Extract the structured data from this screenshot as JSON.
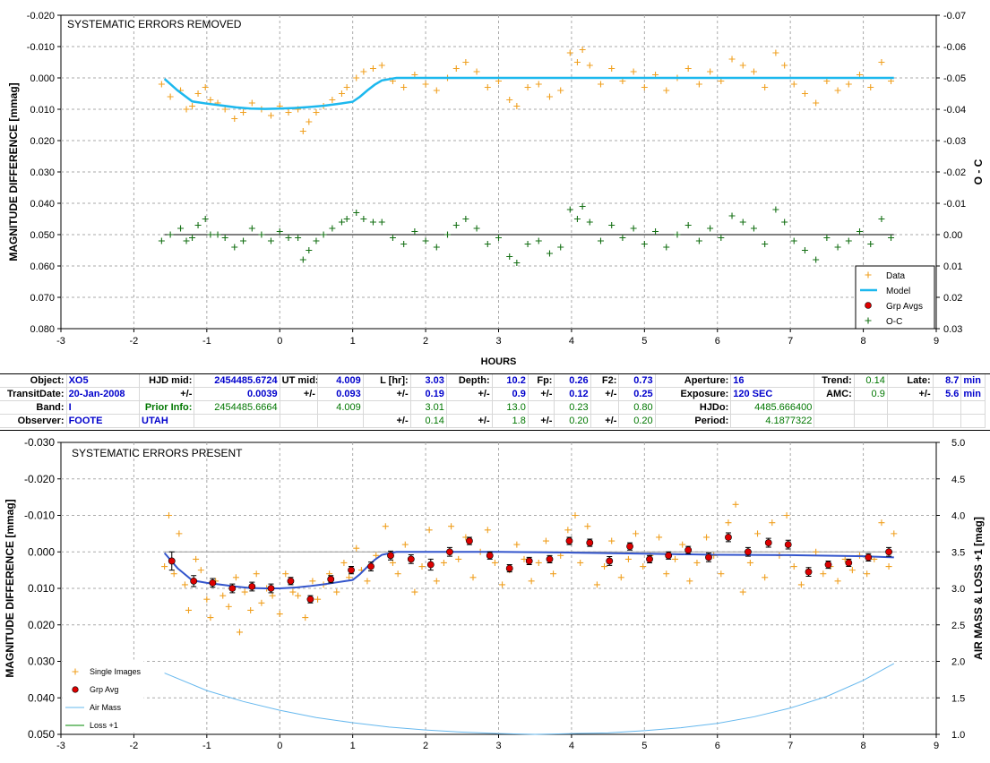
{
  "info_table": {
    "rows": [
      [
        "Object:",
        "XO5",
        "HJD mid:",
        "2454485.6724",
        "UT mid:",
        "4.009",
        "L [hr]:",
        "3.03",
        "Depth:",
        "10.2",
        "Fp:",
        "0.26",
        "F2:",
        "0.73",
        "Aperture:",
        "16",
        "Trend:",
        "0.14",
        "Late:",
        "8.7",
        "min"
      ],
      [
        "TransitDate:",
        "20-Jan-2008",
        "+/-",
        "0.0039",
        "+/-",
        "0.093",
        "+/-",
        "0.19",
        "+/-",
        "0.9",
        "+/-",
        "0.12",
        "+/-",
        "0.25",
        "Exposure:",
        "120 SEC",
        "AMC:",
        "0.9",
        "+/-",
        "5.6",
        "min"
      ],
      [
        "Band:",
        "I",
        "Prior Info:",
        "2454485.6664",
        "",
        "4.009",
        "",
        "3.01",
        "",
        "13.0",
        "",
        "0.23",
        "",
        "0.80",
        "HJDo:",
        "4485.666400",
        "",
        "",
        "",
        "",
        ""
      ],
      [
        "Observer:",
        "FOOTE",
        "UTAH",
        "",
        "",
        "",
        "+/-",
        "0.14",
        "+/-",
        "1.8",
        "+/-",
        "0.20",
        "+/-",
        "0.20",
        "Period:",
        "4.1877322",
        "",
        "",
        "",
        "",
        ""
      ]
    ]
  },
  "chart_data": [
    {
      "type": "scatter",
      "title": "SYSTEMATIC ERRORS REMOVED",
      "xlabel": "HOURS",
      "ylabel": "MAGNITUDE DIFFERENCE [mmag]",
      "y2label": "O - C",
      "xlim": [
        -3,
        9
      ],
      "ylim": [
        -0.02,
        0.08
      ],
      "y_inverted": true,
      "y2lim": [
        -0.07,
        0.03
      ],
      "x_ticks": [
        "-3",
        "-2",
        "-1",
        "0",
        "1",
        "2",
        "3",
        "4",
        "5",
        "6",
        "7",
        "8",
        "9"
      ],
      "y_ticks": [
        "-0.020",
        "-0.010",
        "0.000",
        "0.010",
        "0.020",
        "0.030",
        "0.040",
        "0.050",
        "0.060",
        "0.070",
        "0.080"
      ],
      "y2_ticks": [
        "-0.07",
        "-0.06",
        "-0.05",
        "-0.04",
        "-0.03",
        "-0.02",
        "-0.01",
        "0.00",
        "0.01",
        "0.02",
        "0.03"
      ],
      "grid": true,
      "legend_position": "bottom-right",
      "legend": [
        "Data",
        "Model",
        "Grp Avgs",
        "O-C"
      ],
      "colors": {
        "data": "#f0a020",
        "model": "#1cb8ee",
        "oc": "#157015",
        "grp": "#dd0000",
        "ref": "#000000"
      },
      "model": {
        "x": [
          -1.58,
          -1.4,
          -1.2,
          -1.0,
          -0.8,
          -0.6,
          -0.4,
          -0.2,
          0.0,
          0.2,
          0.4,
          0.6,
          0.8,
          1.0,
          1.1,
          1.2,
          1.3,
          1.4,
          1.6,
          2.0,
          3.0,
          4.0,
          5.0,
          6.0,
          7.0,
          8.0,
          8.42
        ],
        "y": [
          0.0003,
          0.004,
          0.0075,
          0.0082,
          0.0088,
          0.0094,
          0.0098,
          0.0099,
          0.0098,
          0.0096,
          0.0093,
          0.0089,
          0.0083,
          0.0076,
          0.006,
          0.004,
          0.0022,
          0.0008,
          0.0,
          0.0,
          0.0,
          0.0,
          0.0,
          0.0,
          0.0,
          0.0,
          0.0
        ]
      },
      "data_points": {
        "x": [
          -1.62,
          -1.5,
          -1.36,
          -1.28,
          -1.2,
          -1.12,
          -1.02,
          -0.95,
          -0.85,
          -0.75,
          -0.62,
          -0.5,
          -0.38,
          -0.25,
          -0.12,
          0.0,
          0.12,
          0.25,
          0.32,
          0.4,
          0.5,
          0.6,
          0.72,
          0.85,
          0.92,
          1.05,
          1.15,
          1.28,
          1.4,
          1.55,
          1.7,
          1.85,
          2.0,
          2.15,
          2.3,
          2.42,
          2.55,
          2.7,
          2.85,
          3.0,
          3.15,
          3.25,
          3.4,
          3.55,
          3.7,
          3.85,
          3.98,
          4.08,
          4.15,
          4.25,
          4.4,
          4.55,
          4.7,
          4.85,
          5.0,
          5.15,
          5.3,
          5.45,
          5.6,
          5.75,
          5.9,
          6.05,
          6.2,
          6.35,
          6.5,
          6.65,
          6.8,
          6.92,
          7.05,
          7.2,
          7.35,
          7.5,
          7.65,
          7.8,
          7.95,
          8.1,
          8.25,
          8.38
        ],
        "y": [
          0.002,
          0.006,
          0.004,
          0.01,
          0.009,
          0.005,
          0.003,
          0.007,
          0.008,
          0.01,
          0.013,
          0.011,
          0.008,
          0.01,
          0.012,
          0.009,
          0.011,
          0.01,
          0.017,
          0.014,
          0.011,
          0.009,
          0.007,
          0.005,
          0.003,
          0.0,
          -0.002,
          -0.003,
          -0.004,
          0.001,
          0.003,
          -0.001,
          0.002,
          0.004,
          0.0,
          -0.003,
          -0.005,
          -0.002,
          0.003,
          0.001,
          0.007,
          0.009,
          0.003,
          0.002,
          0.006,
          0.004,
          -0.008,
          -0.005,
          -0.009,
          -0.004,
          0.002,
          -0.003,
          0.001,
          -0.002,
          0.003,
          -0.001,
          0.004,
          0.0,
          -0.003,
          0.002,
          -0.002,
          0.001,
          -0.006,
          -0.004,
          -0.002,
          0.003,
          -0.008,
          -0.004,
          0.002,
          0.005,
          0.008,
          0.001,
          0.004,
          0.002,
          -0.001,
          0.003,
          -0.005,
          0.001
        ]
      },
      "oc_points": {
        "x": [
          -1.62,
          -1.5,
          -1.36,
          -1.28,
          -1.2,
          -1.12,
          -1.02,
          -0.95,
          -0.85,
          -0.75,
          -0.62,
          -0.5,
          -0.38,
          -0.25,
          -0.12,
          0.0,
          0.12,
          0.25,
          0.32,
          0.4,
          0.5,
          0.6,
          0.72,
          0.85,
          0.92,
          1.05,
          1.15,
          1.28,
          1.4,
          1.55,
          1.7,
          1.85,
          2.0,
          2.15,
          2.3,
          2.42,
          2.55,
          2.7,
          2.85,
          3.0,
          3.15,
          3.25,
          3.4,
          3.55,
          3.7,
          3.85,
          3.98,
          4.08,
          4.15,
          4.25,
          4.4,
          4.55,
          4.7,
          4.85,
          5.0,
          5.15,
          5.3,
          5.45,
          5.6,
          5.75,
          5.9,
          6.05,
          6.2,
          6.35,
          6.5,
          6.65,
          6.8,
          6.92,
          7.05,
          7.2,
          7.35,
          7.5,
          7.65,
          7.8,
          7.95,
          8.1,
          8.25,
          8.38
        ],
        "y": [
          0.002,
          0.0,
          -0.002,
          0.002,
          0.001,
          -0.003,
          -0.005,
          0.0,
          0.0,
          0.001,
          0.004,
          0.002,
          -0.002,
          0.0,
          0.002,
          -0.001,
          0.001,
          0.001,
          0.008,
          0.005,
          0.002,
          0.0,
          -0.002,
          -0.004,
          -0.005,
          -0.007,
          -0.005,
          -0.004,
          -0.004,
          0.001,
          0.003,
          -0.001,
          0.002,
          0.004,
          0.0,
          -0.003,
          -0.005,
          -0.002,
          0.003,
          0.001,
          0.007,
          0.009,
          0.003,
          0.002,
          0.006,
          0.004,
          -0.008,
          -0.005,
          -0.009,
          -0.004,
          0.002,
          -0.003,
          0.001,
          -0.002,
          0.003,
          -0.001,
          0.004,
          0.0,
          -0.003,
          0.002,
          -0.002,
          0.001,
          -0.006,
          -0.004,
          -0.002,
          0.003,
          -0.008,
          -0.004,
          0.002,
          0.005,
          0.008,
          0.001,
          0.004,
          0.002,
          -0.001,
          0.003,
          -0.005,
          0.001
        ]
      }
    },
    {
      "type": "scatter",
      "title": "SYSTEMATIC ERRORS PRESENT",
      "ylabel": "MAGNITUDE DIFFERENCE [mmag]",
      "y2label": "AIR MASS & LOSS +1 [mag]",
      "xlim": [
        -3,
        9
      ],
      "ylim": [
        -0.03,
        0.05
      ],
      "y_inverted": true,
      "y2lim": [
        1.0,
        5.0
      ],
      "x_ticks": [
        "-3",
        "-2",
        "-1",
        "0",
        "1",
        "2",
        "3",
        "4",
        "5",
        "6",
        "7",
        "8",
        "9"
      ],
      "y_ticks": [
        "-0.030",
        "-0.020",
        "-0.010",
        "0.000",
        "0.010",
        "0.020",
        "0.030",
        "0.040",
        "0.050"
      ],
      "y2_ticks": [
        "5.0",
        "4.5",
        "4.0",
        "3.5",
        "3.0",
        "2.5",
        "2.0",
        "1.5",
        "1.0"
      ],
      "grid": true,
      "legend_position": "bottom-left",
      "legend": [
        "Single Images",
        "Grp Avg",
        "Air Mass",
        "Loss +1"
      ],
      "colors": {
        "data": "#f0a020",
        "model": "#3355cc",
        "grp": "#dd0000",
        "airmass": "#66b8ee",
        "loss": "#008800",
        "ref": "#999999"
      },
      "model": {
        "x": [
          -1.58,
          -1.4,
          -1.2,
          -1.0,
          -0.8,
          -0.6,
          -0.4,
          -0.2,
          0.0,
          0.2,
          0.4,
          0.6,
          0.8,
          1.0,
          1.1,
          1.2,
          1.3,
          1.4,
          1.6,
          2.0,
          3.0,
          4.0,
          5.0,
          6.0,
          7.0,
          8.0,
          8.42
        ],
        "y": [
          0.0003,
          0.0045,
          0.0078,
          0.0085,
          0.009,
          0.0095,
          0.0099,
          0.01,
          0.01,
          0.0098,
          0.0094,
          0.0089,
          0.0083,
          0.0077,
          0.0061,
          0.0041,
          0.0022,
          0.0008,
          0.0,
          0.0,
          0.0,
          0.0002,
          0.0005,
          0.0008,
          0.0009,
          0.0012,
          0.0015
        ]
      },
      "ref_line": {
        "x": [
          -1.58,
          8.42
        ],
        "y": [
          0.0,
          0.0
        ]
      },
      "grp_avgs": {
        "x": [
          -1.48,
          -1.18,
          -0.92,
          -0.65,
          -0.38,
          -0.12,
          0.15,
          0.42,
          0.7,
          0.98,
          1.25,
          1.52,
          1.8,
          2.07,
          2.33,
          2.6,
          2.88,
          3.15,
          3.42,
          3.7,
          3.97,
          4.25,
          4.52,
          4.8,
          5.07,
          5.33,
          5.6,
          5.88,
          6.15,
          6.42,
          6.7,
          6.97,
          7.25,
          7.52,
          7.8,
          8.07,
          8.35
        ],
        "y": [
          0.0025,
          0.008,
          0.0085,
          0.01,
          0.0095,
          0.01,
          0.008,
          0.013,
          0.0075,
          0.005,
          0.004,
          0.001,
          0.002,
          0.0035,
          0.0,
          -0.003,
          0.001,
          0.0045,
          0.0025,
          0.002,
          -0.003,
          -0.0025,
          0.0025,
          -0.0015,
          0.002,
          0.001,
          -0.0005,
          0.0015,
          -0.004,
          0.0,
          -0.0025,
          -0.002,
          0.0055,
          0.0035,
          0.003,
          0.0015,
          0.0
        ]
      },
      "grp_err": [
        0.0025,
        0.0015,
        0.0012,
        0.0012,
        0.0012,
        0.0012,
        0.001,
        0.001,
        0.001,
        0.001,
        0.0012,
        0.0012,
        0.0012,
        0.0015,
        0.0012,
        0.001,
        0.001,
        0.001,
        0.001,
        0.001,
        0.001,
        0.001,
        0.0012,
        0.001,
        0.001,
        0.001,
        0.001,
        0.0012,
        0.0012,
        0.0012,
        0.0012,
        0.0012,
        0.0012,
        0.001,
        0.001,
        0.001,
        0.0012
      ],
      "data_points": {
        "x": [
          -1.58,
          -1.52,
          -1.45,
          -1.38,
          -1.3,
          -1.25,
          -1.15,
          -1.08,
          -1.0,
          -0.95,
          -0.88,
          -0.78,
          -0.7,
          -0.6,
          -0.55,
          -0.48,
          -0.4,
          -0.32,
          -0.25,
          -0.18,
          -0.1,
          0.0,
          0.08,
          0.18,
          0.25,
          0.35,
          0.45,
          0.52,
          0.6,
          0.68,
          0.78,
          0.88,
          0.95,
          1.05,
          1.12,
          1.2,
          1.32,
          1.45,
          1.55,
          1.62,
          1.72,
          1.85,
          1.95,
          2.05,
          2.15,
          2.25,
          2.35,
          2.45,
          2.55,
          2.65,
          2.75,
          2.85,
          2.95,
          3.05,
          3.15,
          3.25,
          3.35,
          3.45,
          3.55,
          3.65,
          3.75,
          3.85,
          3.95,
          4.05,
          4.12,
          4.22,
          4.35,
          4.45,
          4.55,
          4.68,
          4.78,
          4.88,
          4.98,
          5.08,
          5.2,
          5.3,
          5.42,
          5.52,
          5.62,
          5.72,
          5.85,
          5.95,
          6.05,
          6.15,
          6.25,
          6.35,
          6.45,
          6.55,
          6.65,
          6.75,
          6.85,
          6.95,
          7.05,
          7.15,
          7.25,
          7.35,
          7.45,
          7.55,
          7.65,
          7.75,
          7.85,
          7.95,
          8.05,
          8.15,
          8.25,
          8.35,
          8.42
        ],
        "y": [
          0.004,
          -0.01,
          0.006,
          -0.005,
          0.009,
          0.016,
          0.002,
          0.005,
          0.013,
          0.018,
          0.008,
          0.012,
          0.015,
          0.007,
          0.022,
          0.011,
          0.016,
          0.006,
          0.014,
          0.01,
          0.012,
          0.017,
          0.006,
          0.011,
          0.012,
          0.018,
          0.008,
          0.013,
          0.009,
          0.006,
          0.011,
          0.003,
          0.007,
          -0.001,
          0.005,
          0.008,
          0.001,
          -0.007,
          0.003,
          0.006,
          -0.002,
          0.011,
          0.004,
          -0.006,
          0.008,
          0.003,
          -0.007,
          0.002,
          -0.004,
          0.007,
          0.0,
          -0.006,
          0.003,
          0.009,
          0.005,
          -0.002,
          0.002,
          0.008,
          0.003,
          -0.003,
          0.006,
          0.001,
          -0.006,
          -0.01,
          0.003,
          -0.007,
          0.009,
          0.004,
          -0.003,
          0.007,
          0.002,
          -0.005,
          0.004,
          0.001,
          -0.004,
          0.006,
          0.002,
          -0.002,
          0.008,
          0.003,
          -0.004,
          0.001,
          0.006,
          -0.008,
          -0.013,
          0.011,
          0.003,
          -0.005,
          0.007,
          -0.008,
          0.001,
          -0.01,
          0.004,
          0.009,
          0.005,
          0.0,
          0.006,
          0.004,
          0.008,
          0.002,
          0.005,
          0.001,
          0.006,
          0.002,
          -0.008,
          0.004,
          -0.005
        ]
      },
      "air_mass": {
        "x": [
          -1.58,
          -1.0,
          -0.5,
          0.0,
          0.5,
          1.0,
          1.5,
          2.0,
          2.5,
          3.0,
          3.5,
          4.0,
          4.5,
          5.0,
          5.5,
          6.0,
          6.5,
          7.0,
          7.5,
          8.0,
          8.42
        ],
        "y": [
          1.84,
          1.6,
          1.45,
          1.33,
          1.23,
          1.16,
          1.1,
          1.06,
          1.03,
          1.01,
          1.0,
          1.01,
          1.02,
          1.05,
          1.09,
          1.15,
          1.24,
          1.36,
          1.52,
          1.74,
          1.97
        ]
      }
    }
  ]
}
